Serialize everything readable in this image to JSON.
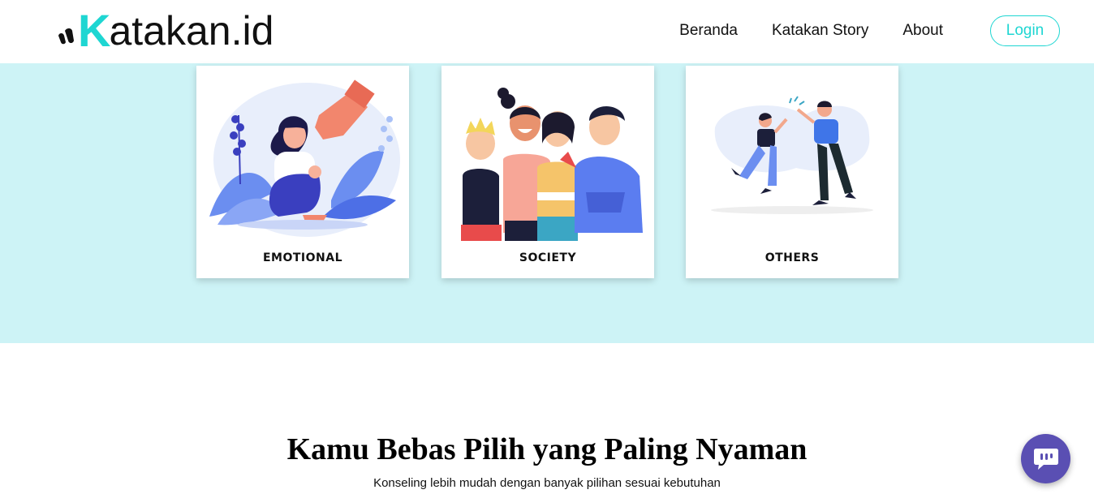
{
  "brand": {
    "logo_letter": "K",
    "logo_rest": "atakan.id",
    "accent_color": "#1ed6d2"
  },
  "nav": {
    "items": [
      {
        "label": "Beranda"
      },
      {
        "label": "Katakan Story"
      },
      {
        "label": "About"
      }
    ],
    "login_label": "Login"
  },
  "categories": [
    {
      "label": "EMOTIONAL",
      "icon": "sad-woman-illustration"
    },
    {
      "label": "SOCIETY",
      "icon": "group-of-friends-illustration"
    },
    {
      "label": "OTHERS",
      "icon": "high-five-illustration"
    }
  ],
  "section": {
    "title": "Kamu Bebas Pilih yang Paling Nyaman",
    "subtitle": "Konseling lebih mudah dengan banyak pilihan sesuai kebutuhan"
  },
  "chat": {
    "icon": "chat-bubble-icon",
    "color": "#5a4fb3"
  },
  "band_color": "#cdf3f6"
}
